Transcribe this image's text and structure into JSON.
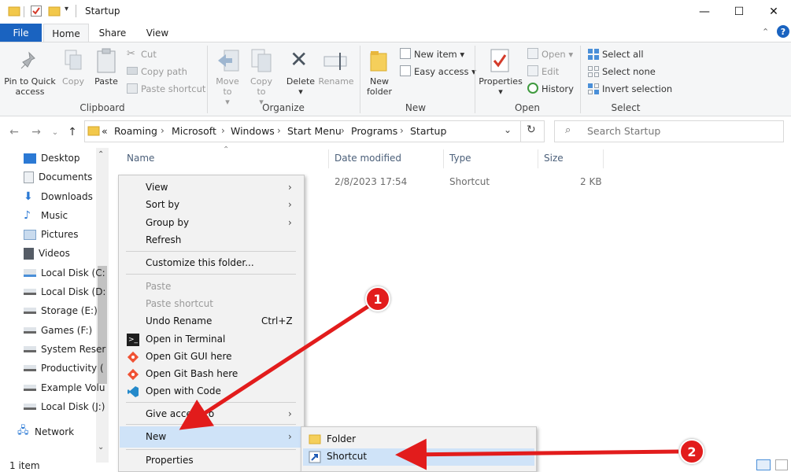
{
  "window": {
    "title": "Startup",
    "controls": {
      "minimize": "—",
      "maximize": "☐",
      "close": "✕"
    }
  },
  "ribbon": {
    "tabs": [
      "File",
      "Home",
      "Share",
      "View"
    ],
    "clipboard": {
      "label": "Clipboard",
      "pin": "Pin to Quick access",
      "copy": "Copy",
      "paste": "Paste",
      "cut": "Cut",
      "copy_path": "Copy path",
      "paste_shortcut": "Paste shortcut"
    },
    "organize": {
      "label": "Organize",
      "move_to": "Move to",
      "copy_to": "Copy to",
      "delete": "Delete",
      "rename": "Rename"
    },
    "new": {
      "label": "New",
      "new_folder": "New folder",
      "new_item": "New item",
      "easy_access": "Easy access"
    },
    "open": {
      "label": "Open",
      "properties": "Properties",
      "open": "Open",
      "edit": "Edit",
      "history": "History"
    },
    "select": {
      "label": "Select",
      "select_all": "Select all",
      "select_none": "Select none",
      "invert": "Invert selection"
    }
  },
  "address": {
    "prefix": "«",
    "crumbs": [
      "Roaming",
      "Microsoft",
      "Windows",
      "Start Menu",
      "Programs",
      "Startup"
    ],
    "search_placeholder": "Search Startup"
  },
  "nav_items": [
    "Desktop",
    "Documents",
    "Downloads",
    "Music",
    "Pictures",
    "Videos",
    "Local Disk (C:",
    "Local Disk (D:",
    "Storage (E:)",
    "Games (F:)",
    "System Reser",
    "Productivity (",
    "Example Volu",
    "Local Disk (J:)",
    "Network"
  ],
  "columns": {
    "name": "Name",
    "date": "Date modified",
    "type": "Type",
    "size": "Size"
  },
  "file_row": {
    "date": "2/8/2023 17:54",
    "type": "Shortcut",
    "size": "2 KB"
  },
  "context_menu": {
    "view": "View",
    "sort_by": "Sort by",
    "group_by": "Group by",
    "refresh": "Refresh",
    "customize": "Customize this folder...",
    "paste": "Paste",
    "paste_shortcut": "Paste shortcut",
    "undo_rename": "Undo Rename",
    "undo_shortcut": "Ctrl+Z",
    "open_terminal": "Open in Terminal",
    "open_git_gui": "Open Git GUI here",
    "open_git_bash": "Open Git Bash here",
    "open_code": "Open with Code",
    "give_access": "Give access to",
    "new": "New",
    "properties": "Properties"
  },
  "submenu": {
    "folder": "Folder",
    "shortcut": "Shortcut"
  },
  "status": {
    "count": "1 item"
  },
  "annotations": {
    "badge1": "1",
    "badge2": "2"
  },
  "colors": {
    "accent": "#1a63c0",
    "highlight": "#cfe3f8",
    "annotation": "#e21c1c"
  }
}
